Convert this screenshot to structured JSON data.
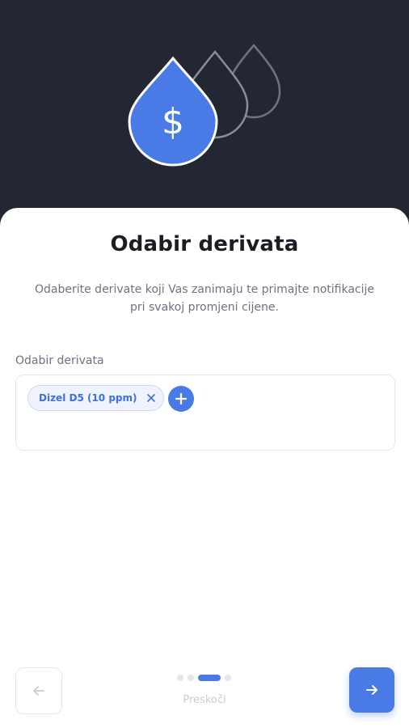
{
  "hero": {
    "icon": "fuel-drop-dollar-icon",
    "symbol": "$"
  },
  "title": "Odabir derivata",
  "subtitle_line1": "Odaberite derivate koji Vas zanimaju te primajte notifikacije",
  "subtitle_line2": "pri svakoj promjeni cijene.",
  "field": {
    "label": "Odabir derivata",
    "chips": [
      {
        "label": "Dizel D5 (10 ppm)"
      }
    ],
    "add_icon": "plus-icon"
  },
  "pagination": {
    "total": 4,
    "current": 3
  },
  "skip_label": "Preskoči",
  "colors": {
    "accent": "#4a7ae6",
    "dark_bg": "#222733"
  }
}
